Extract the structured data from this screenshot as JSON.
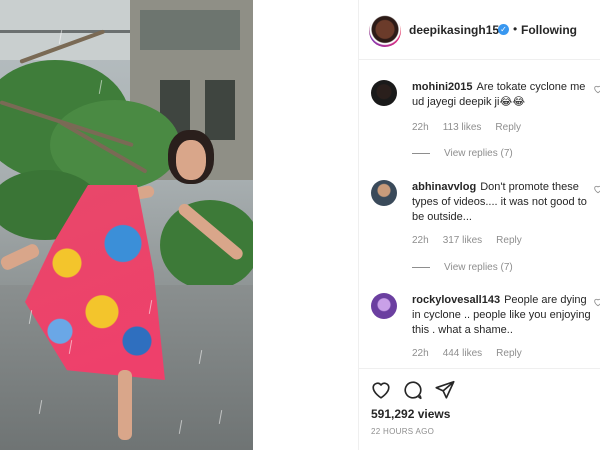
{
  "post": {
    "username": "deepikasingh150",
    "verified_glyph": "✓",
    "separator": "•",
    "follow_status": "Following",
    "views": "591,292 views",
    "timestamp": "22 HOURS AGO"
  },
  "comments": [
    {
      "username": "mohini2015",
      "text": "Are tokate cyclone me ud jayegi deepik ji😂😂",
      "age": "22h",
      "likes": "113 likes",
      "reply_label": "Reply",
      "view_replies": "View replies (7)"
    },
    {
      "username": "abhinavvlog",
      "text": "Don't promote these types of videos.... it was not good to be outside...",
      "age": "22h",
      "likes": "317 likes",
      "reply_label": "Reply",
      "view_replies": "View replies (7)"
    },
    {
      "username": "rockylovesall143",
      "text": "People are dying in cyclone .. people like you enjoying this . what a shame..",
      "age": "22h",
      "likes": "444 likes",
      "reply_label": "Reply"
    }
  ],
  "icons": {
    "like": "heart-icon",
    "comment": "comment-icon",
    "share": "share-icon",
    "comment_like": "heart-outline-icon"
  },
  "colors": {
    "verified": "#3897f0",
    "muted": "#8e8e8e",
    "text": "#262626"
  }
}
